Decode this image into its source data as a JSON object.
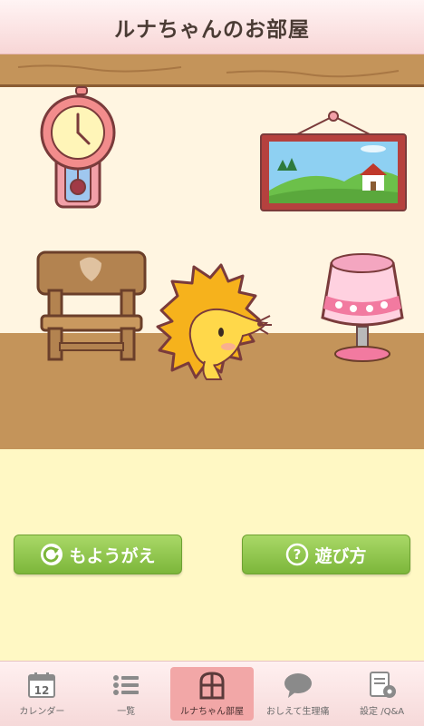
{
  "header": {
    "title": "ルナちゃんのお部屋"
  },
  "buttons": {
    "change_label": "もようがえ",
    "howto_label": "遊び方"
  },
  "tabs": [
    {
      "label": "カレンダー",
      "icon": "calendar-icon",
      "badge": "12"
    },
    {
      "label": "一覧",
      "icon": "list-icon"
    },
    {
      "label": "ルナちゃん部屋",
      "icon": "window-icon",
      "active": true
    },
    {
      "label": "おしえて生理痛",
      "icon": "chat-bubble-icon"
    },
    {
      "label": "設定 /Q&A",
      "icon": "settings-doc-icon"
    }
  ],
  "colors": {
    "header_bg": "#f8d6d6",
    "button_green": "#8cc543",
    "floor": "#c4945a",
    "wall": "#fff5e1",
    "active_tab": "#f2a7a7"
  }
}
